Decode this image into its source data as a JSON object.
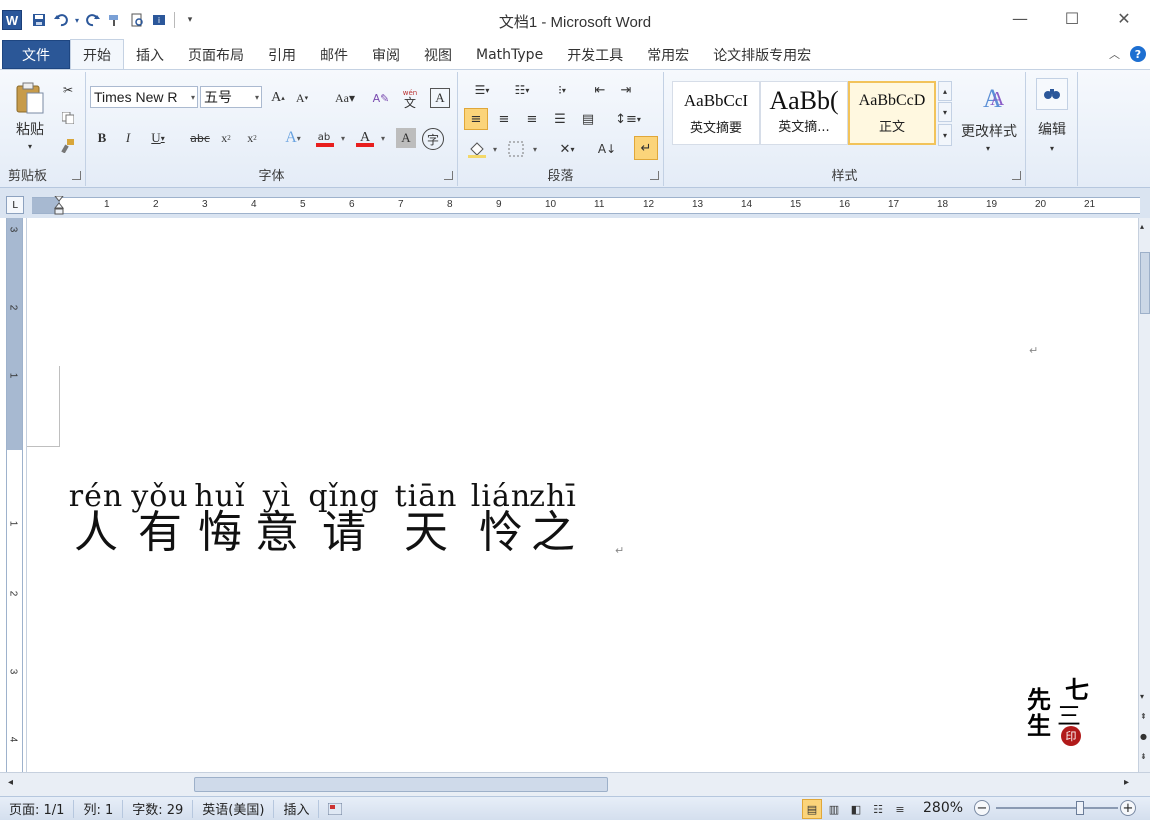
{
  "window": {
    "title": "文档1 - Microsoft Word",
    "app_icon": "W"
  },
  "qat": {
    "icons": [
      "save-icon",
      "undo-icon",
      "redo-icon",
      "customize-icon"
    ]
  },
  "tabs": [
    {
      "label": "文件",
      "id": "file"
    },
    {
      "label": "开始",
      "id": "home"
    },
    {
      "label": "插入",
      "id": "insert"
    },
    {
      "label": "页面布局",
      "id": "layout"
    },
    {
      "label": "引用",
      "id": "references"
    },
    {
      "label": "邮件",
      "id": "mailings"
    },
    {
      "label": "审阅",
      "id": "review"
    },
    {
      "label": "视图",
      "id": "view"
    },
    {
      "label": "MathType",
      "id": "mathtype"
    },
    {
      "label": "开发工具",
      "id": "developer"
    },
    {
      "label": "常用宏",
      "id": "macros"
    },
    {
      "label": "论文排版专用宏",
      "id": "thesis-macros"
    }
  ],
  "ribbon": {
    "clipboard": {
      "label": "剪贴板",
      "paste": "粘贴"
    },
    "font": {
      "label": "字体",
      "font_name": "Times New R",
      "font_size": "五号"
    },
    "paragraph": {
      "label": "段落"
    },
    "styles": {
      "label": "样式",
      "items": [
        {
          "sample": "AaBbCcI",
          "name": "英文摘要"
        },
        {
          "sample": "AaBb(",
          "name": "英文摘..."
        },
        {
          "sample": "AaBbCcD",
          "name": "正文"
        }
      ],
      "change_styles": "更改样式"
    },
    "editing": {
      "label": "编辑"
    }
  },
  "ruler": {
    "h_ticks": [
      "1",
      "2",
      "3",
      "4",
      "5",
      "6",
      "7",
      "8",
      "9",
      "10",
      "11",
      "12",
      "13",
      "14",
      "15",
      "16",
      "17",
      "18",
      "19",
      "20",
      "21"
    ],
    "v_ticks": [
      "3",
      "2",
      "1",
      "1",
      "2",
      "3",
      "4"
    ]
  },
  "document": {
    "ruby": [
      {
        "pinyin": "rén",
        "hanzi": "人"
      },
      {
        "pinyin": "yǒu",
        "hanzi": "有"
      },
      {
        "pinyin": "huǐ",
        "hanzi": "悔"
      },
      {
        "pinyin": "yì",
        "hanzi": "意"
      },
      {
        "pinyin": "qǐng",
        "hanzi": "请"
      },
      {
        "pinyin": "tiān",
        "hanzi": "天"
      },
      {
        "pinyin": "lián",
        "hanzi": "怜"
      },
      {
        "pinyin": "zhī",
        "hanzi": "之"
      }
    ],
    "para_mark": "↵",
    "watermark": {
      "chars": [
        "七",
        "先",
        "三",
        "生"
      ]
    }
  },
  "statusbar": {
    "page": "页面: 1/1",
    "column": "列: 1",
    "word_count": "字数: 29",
    "language": "英语(美国)",
    "mode": "插入",
    "zoom": "280%"
  }
}
